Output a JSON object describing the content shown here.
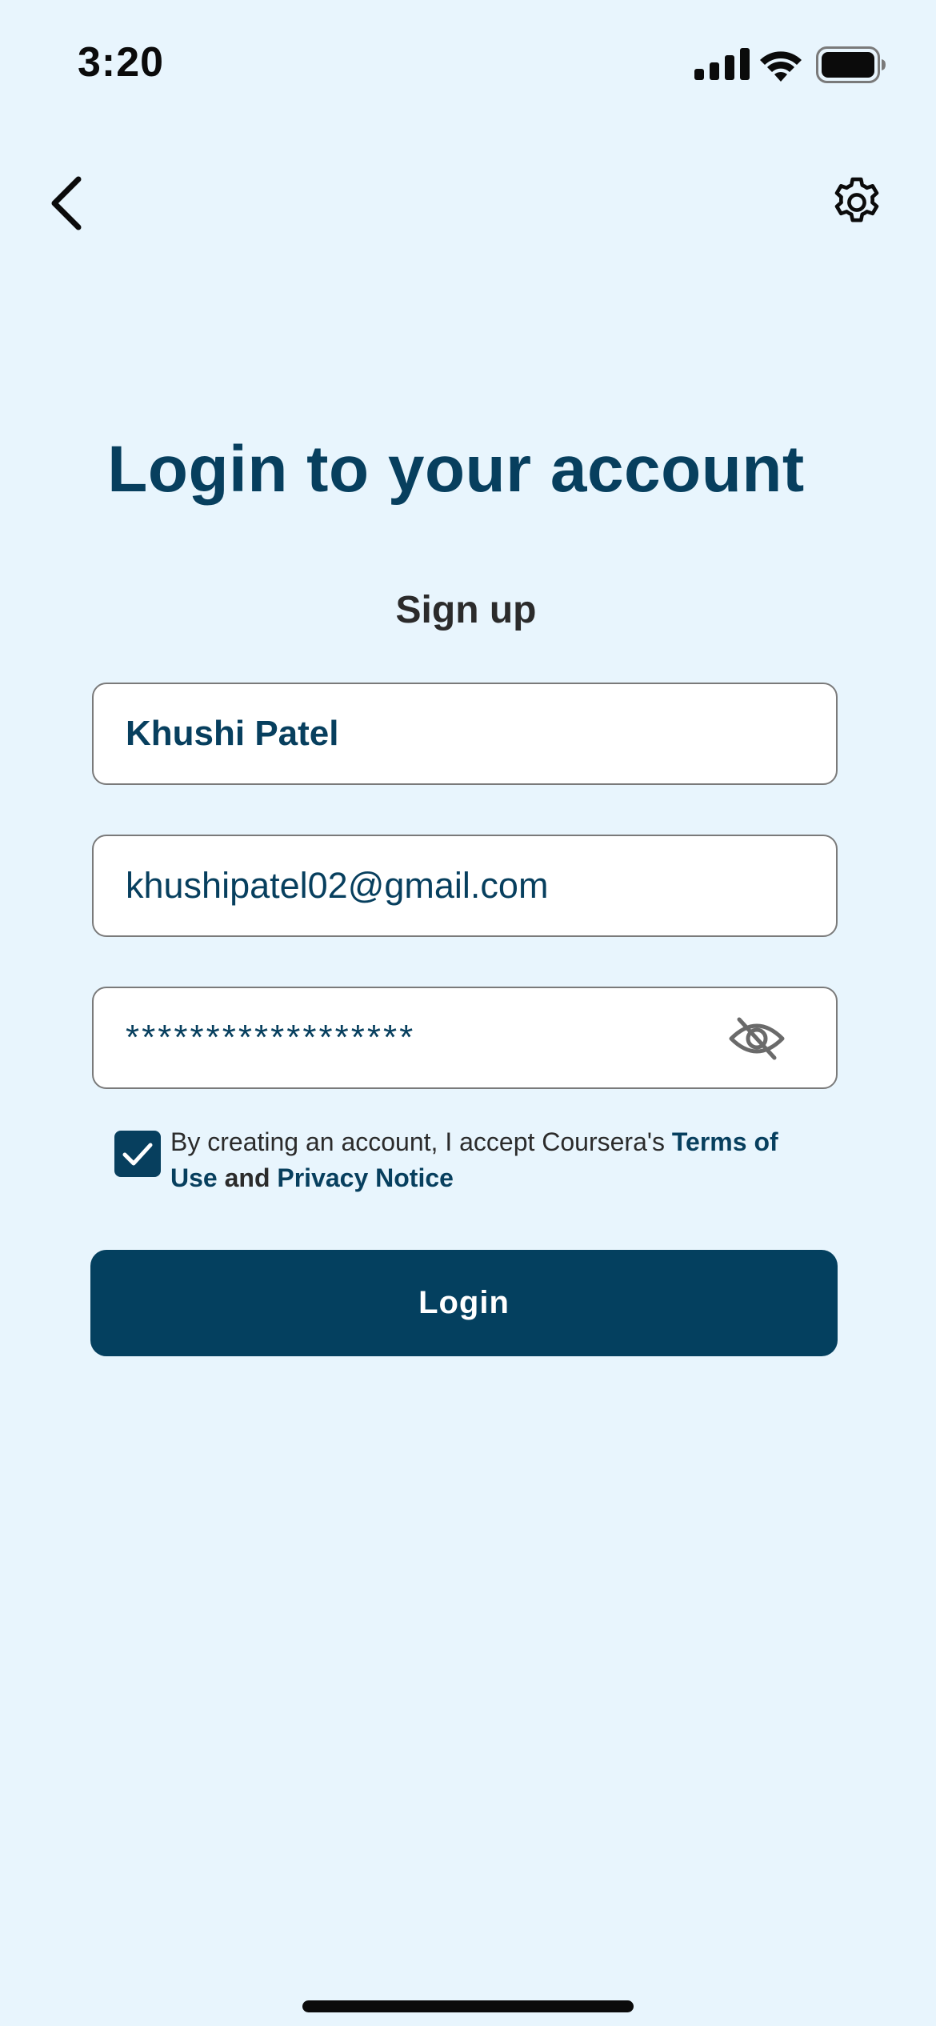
{
  "status_bar": {
    "time": "3:20",
    "icons": [
      "signal-icon",
      "wifi-icon",
      "battery-icon"
    ]
  },
  "nav": {
    "back_icon": "chevron-left-icon",
    "settings_icon": "gear-icon"
  },
  "title": "Login to your account",
  "subtitle": "Sign up",
  "form": {
    "name_value": "Khushi Patel",
    "email_value": "khushipatel02@gmail.com",
    "password_value": "******************",
    "password_toggle_icon": "eye-slash-icon"
  },
  "terms": {
    "checked": true,
    "prefix": "By creating an account, I accept Coursera's ",
    "terms_link": "Terms of Use",
    "conjunction": " and ",
    "privacy_link": "Privacy Notice"
  },
  "login_button": "Login",
  "colors": {
    "background": "#e8f5fd",
    "primary": "#04405f",
    "text_dark": "#2b2b2b",
    "field_border": "#7a7a7a"
  }
}
